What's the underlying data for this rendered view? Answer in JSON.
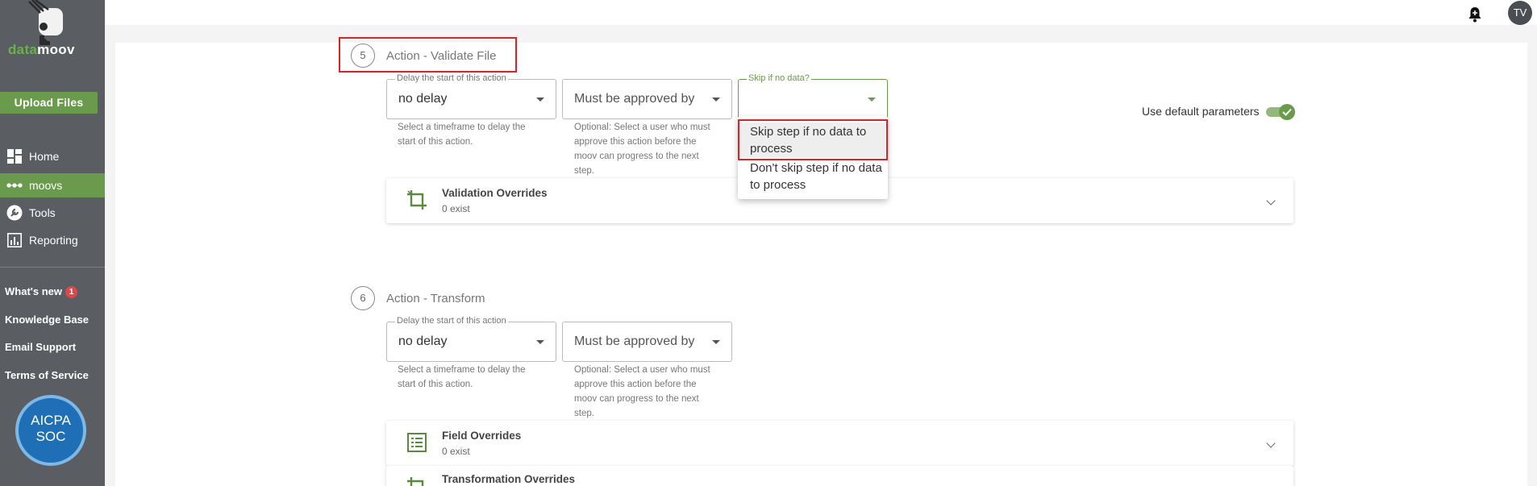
{
  "brand": {
    "logo_part1": "data",
    "logo_part2": "moov"
  },
  "sidebar": {
    "upload_label": "Upload Files",
    "nav": [
      {
        "label": "Home",
        "icon": "dashboard-icon"
      },
      {
        "label": "moovs",
        "icon": "dots-icon",
        "active": true
      },
      {
        "label": "Tools",
        "icon": "wrench-icon"
      },
      {
        "label": "Reporting",
        "icon": "chart-icon"
      }
    ],
    "links": {
      "whats_new": "What's new",
      "whats_new_badge": "1",
      "knowledge_base": "Knowledge Base",
      "email_support": "Email Support",
      "terms": "Terms of Service"
    },
    "aicpa_line1": "AICPA",
    "aicpa_line2": "SOC"
  },
  "header": {
    "avatar_initials": "TV"
  },
  "step5": {
    "number": "5",
    "title": "Action - Validate File",
    "delay": {
      "label": "Delay the start of this action",
      "value": "no delay",
      "help": "Select a timeframe to delay the start of this action."
    },
    "approval": {
      "placeholder": "Must be approved by",
      "help": "Optional: Select a user who must approve this action before the moov can progress to the next step."
    },
    "skip": {
      "label": "Skip if no data?",
      "value": ""
    },
    "default_params_label": "Use default parameters",
    "skip_options": [
      "Skip step if no data to process",
      "Don't skip step if no data to process"
    ],
    "accordion": {
      "title": "Validation Overrides",
      "subtitle": "0 exist"
    }
  },
  "step6": {
    "number": "6",
    "title": "Action - Transform",
    "delay": {
      "label": "Delay the start of this action",
      "value": "no delay",
      "help": "Select a timeframe to delay the start of this action."
    },
    "approval": {
      "placeholder": "Must be approved by",
      "help": "Optional: Select a user who must approve this action before the moov can progress to the next step."
    },
    "accordions": [
      {
        "title": "Field Overrides",
        "subtitle": "0 exist"
      },
      {
        "title": "Transformation Overrides",
        "subtitle": ""
      }
    ]
  },
  "colors": {
    "accent": "#6a9a4c",
    "sidebar": "#5a5d62",
    "highlight": "#d8232a"
  }
}
